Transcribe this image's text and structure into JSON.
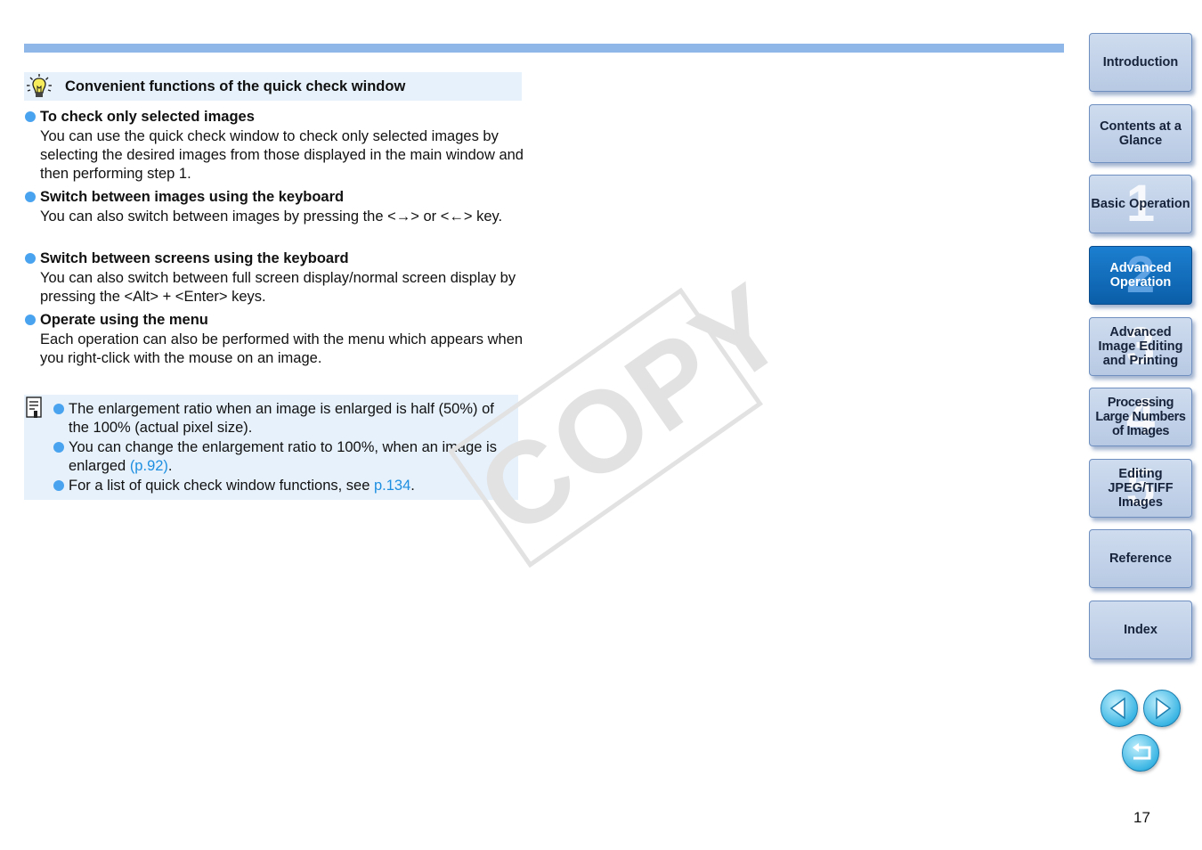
{
  "tip": {
    "title": "Convenient functions of the quick check window",
    "icon": "lightbulb-icon"
  },
  "sections": [
    {
      "heading": "To check only selected images",
      "body": "You can use the quick check window to check only selected images by selecting the desired images from those displayed in the main window and then performing step 1."
    },
    {
      "heading": "Switch between images using the keyboard",
      "body": "You can also switch between images by pressing the <→> or <←> key."
    },
    {
      "heading": "Switch between screens using the keyboard",
      "body": "You can also switch between full screen display/normal screen display by pressing the <Alt> + <Enter> keys."
    },
    {
      "heading": "Operate using the menu",
      "body": "Each operation can also be performed with the menu which appears when you right-click with the mouse on an image."
    }
  ],
  "memo": {
    "icon": "memo-icon",
    "items": [
      {
        "text": "The enlargement ratio when an image is enlarged is half (50%) of the 100% (actual pixel size).",
        "link": "",
        "after": ""
      },
      {
        "text": "You can change the enlargement ratio to 100%, when an image is enlarged ",
        "link": "(p.92)",
        "after": "."
      },
      {
        "text": "For a list of quick check window functions, see ",
        "link": "p.134",
        "after": "."
      }
    ]
  },
  "watermark": "COPY",
  "nav": [
    {
      "label": "Introduction",
      "num": ""
    },
    {
      "label": "Contents at a Glance",
      "num": ""
    },
    {
      "label": "Basic Operation",
      "num": "1"
    },
    {
      "label": "Advanced Operation",
      "num": "2"
    },
    {
      "label": "Advanced Image Editing and Printing",
      "num": "3"
    },
    {
      "label": "Processing Large Numbers of Images",
      "num": "4"
    },
    {
      "label": "Editing JPEG/TIFF Images",
      "num": "5"
    },
    {
      "label": "Reference",
      "num": ""
    },
    {
      "label": "Index",
      "num": ""
    }
  ],
  "nav_active_index": 3,
  "controls": {
    "prev_icon": "arrow-left-icon",
    "next_icon": "arrow-right-icon",
    "back_icon": "return-icon"
  },
  "page_number": "17",
  "colors": {
    "accent": "#8fb8e9",
    "bullet": "#4aa3ef",
    "link": "#1e8fe0",
    "active_tab": "#0b5ea8"
  }
}
